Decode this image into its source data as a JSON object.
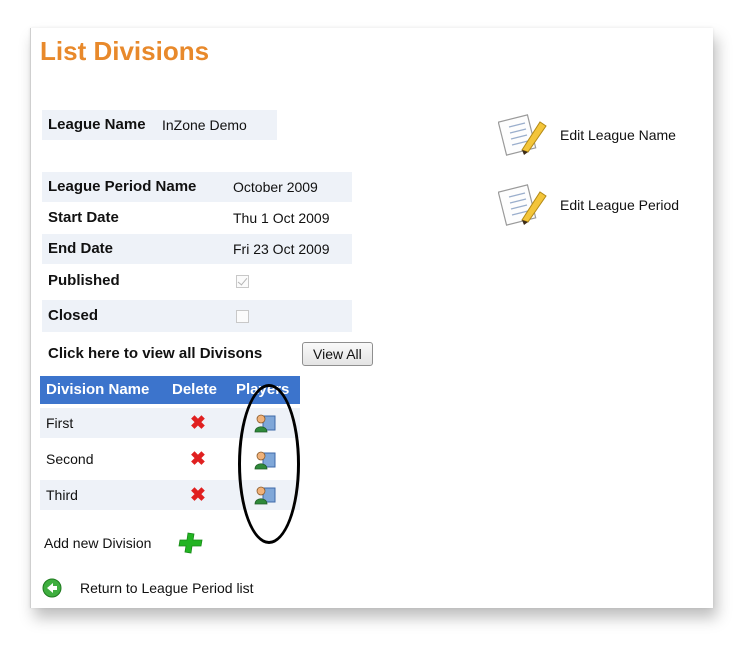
{
  "page_title": "List Divisions",
  "league": {
    "name_label": "League Name",
    "name_value": "InZone Demo"
  },
  "period": {
    "name_label": "League Period Name",
    "name_value": "October 2009",
    "start_label": "Start Date",
    "start_value": "Thu 1 Oct 2009",
    "end_label": "End Date",
    "end_value": "Fri 23 Oct 2009",
    "published_label": "Published",
    "published_checked": true,
    "closed_label": "Closed",
    "closed_checked": false
  },
  "actions": {
    "edit_league_name": "Edit League Name",
    "edit_league_period": "Edit League Period"
  },
  "view_all": {
    "prompt": "Click here to view all Divisons",
    "button": "View All"
  },
  "table": {
    "headers": [
      "Division Name",
      "Delete",
      "Players"
    ],
    "rows": [
      {
        "name": "First",
        "delete": "✖"
      },
      {
        "name": "Second",
        "delete": "✖"
      },
      {
        "name": "Third",
        "delete": "✖"
      }
    ]
  },
  "add_division": "Add new Division",
  "return_link": "Return to League Period list",
  "colors": {
    "title": "#e8892b",
    "table_header": "#3c74cc",
    "delete": "#e02020",
    "add": "#22b422"
  }
}
